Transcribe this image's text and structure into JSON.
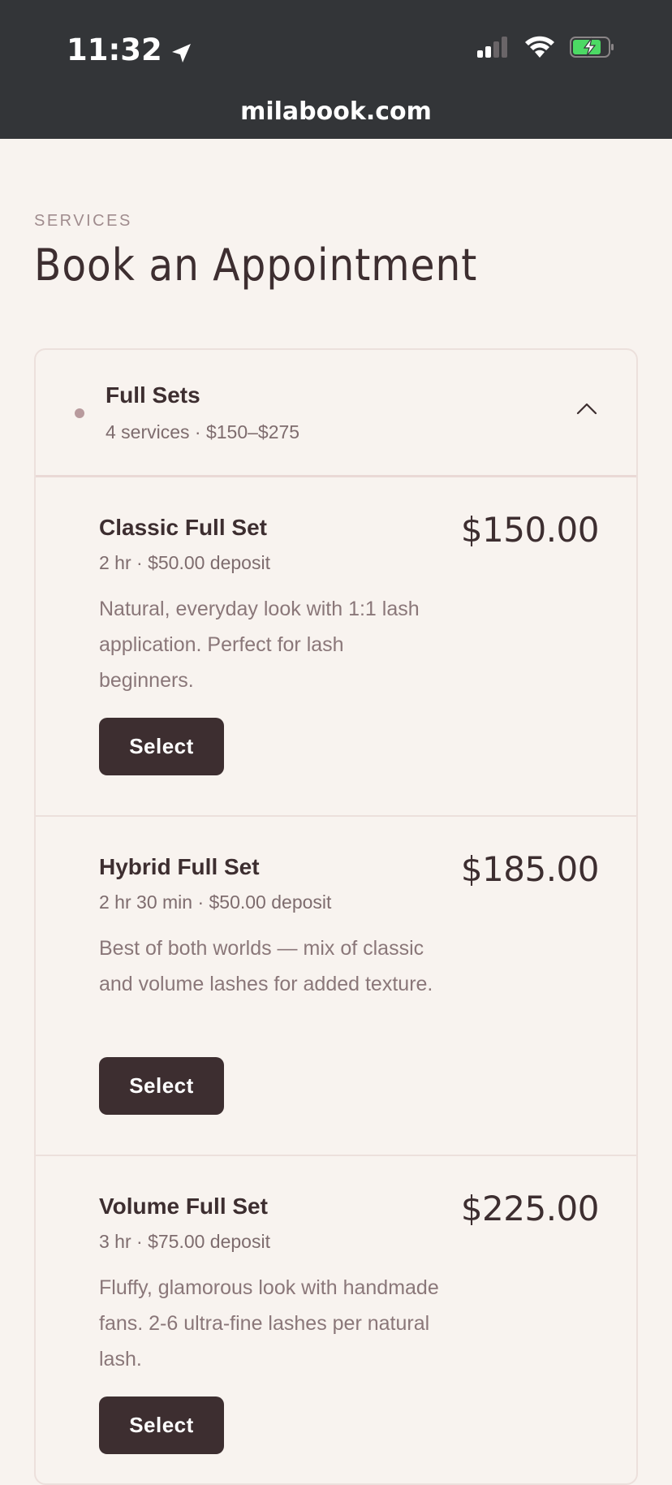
{
  "status_bar": {
    "time": "11:32",
    "url": "milabook.com"
  },
  "header": {
    "eyebrow": "SERVICES",
    "title": "Book an Appointment"
  },
  "category": {
    "name": "Full Sets",
    "meta": "4 services · $150–$275"
  },
  "services": [
    {
      "name": "Classic Full Set",
      "meta": "2 hr · $50.00 deposit",
      "description": "Natural, everyday look with 1:1 lash application. Perfect for lash beginners.",
      "price": "$150.00",
      "button": "Select"
    },
    {
      "name": "Hybrid Full Set",
      "meta": "2 hr 30 min · $50.00 deposit",
      "description": "Best of both worlds — mix of classic and volume lashes for added texture.",
      "price": "$185.00",
      "button": "Select"
    },
    {
      "name": "Volume Full Set",
      "meta": "3 hr · $75.00 deposit",
      "description": "Fluffy, glamorous look with handmade fans. 2-6 ultra-fine lashes per natural lash.",
      "price": "$225.00",
      "button": "Select"
    }
  ],
  "colors": {
    "background": "#f8f3ef",
    "status_bar": "#333538",
    "accent": "#3d2e30",
    "battery_green": "#4cd964"
  },
  "icons": {
    "location": "location-arrow-icon",
    "signal": "cellular-signal-icon",
    "wifi": "wifi-icon",
    "battery": "battery-charging-icon",
    "collapse": "chevron-up-icon"
  }
}
